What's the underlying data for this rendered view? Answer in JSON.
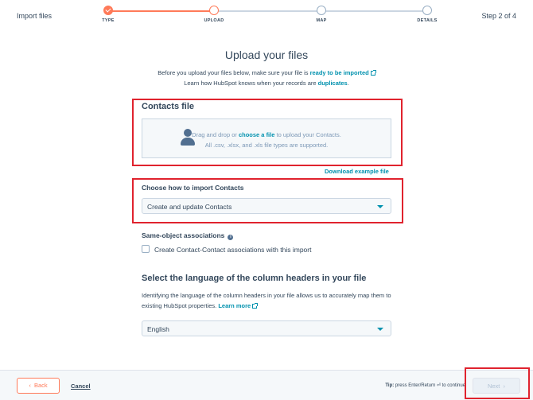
{
  "header": {
    "left_label": "Import files",
    "right_label": "Step 2 of 4",
    "steps": [
      {
        "label": "TYPE",
        "state": "done"
      },
      {
        "label": "UPLOAD",
        "state": "active"
      },
      {
        "label": "MAP",
        "state": "pending"
      },
      {
        "label": "DETAILS",
        "state": "pending"
      }
    ]
  },
  "main": {
    "title": "Upload your files",
    "intro_line1_prefix": "Before you upload your files below, make sure your file is",
    "intro_line1_link": "ready to be imported",
    "intro_line2_prefix": "Learn how HubSpot knows when your records are",
    "intro_line2_link": "duplicates",
    "intro_line2_suffix": "."
  },
  "contacts_file": {
    "title": "Contacts file",
    "drop_prefix": "Drag and drop or",
    "drop_link": "choose a file",
    "drop_suffix": "to upload your Contacts.",
    "drop_line2": "All .csv, .xlsx, and .xls file types are supported.",
    "download_link": "Download example file"
  },
  "import_mode": {
    "title": "Choose how to import Contacts",
    "selected": "Create and update Contacts"
  },
  "associations": {
    "title": "Same-object associations",
    "info_icon": "info-icon",
    "checkbox_label": "Create Contact-Contact associations with this import",
    "checked": false
  },
  "language": {
    "heading": "Select the language of the column headers in your file",
    "para": "Identifying the language of the column headers in your file allows us to accurately map them to existing HubSpot properties.",
    "learn_more": "Learn more",
    "selected": "English"
  },
  "footer": {
    "back_label": "Back",
    "cancel_label": "Cancel",
    "tip_bold": "Tip:",
    "tip_text": "press Enter/Return ⏎ to continue",
    "next_label": "Next"
  },
  "colors": {
    "accent": "#ff7a59",
    "link": "#0091ae",
    "highlight": "#e0232e"
  }
}
